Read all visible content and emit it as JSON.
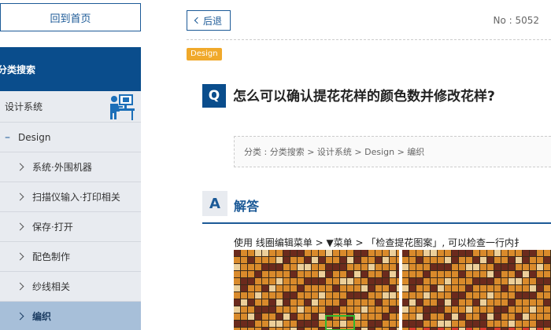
{
  "sidebar": {
    "home_label": "回到首页",
    "category_header": "分类搜索",
    "menu": {
      "system_label": "设计系统",
      "design_label": "Design",
      "design_toggle": "–",
      "items": [
        {
          "label": "系统·外围机器"
        },
        {
          "label": "扫描仪输入·打印相关"
        },
        {
          "label": "保存·打开"
        },
        {
          "label": "配色制作"
        },
        {
          "label": "纱线相关"
        },
        {
          "label": "编织",
          "active": true
        }
      ]
    }
  },
  "main": {
    "back_label": "后退",
    "number": "No : 5052",
    "tag": "Design",
    "q_mark": "Q",
    "question": "怎么可以确认提花花样的颜色数并修改花样?",
    "breadcrumb": "分类 : 分类搜索 > 设计系统 > Design > 编织",
    "a_mark": "A",
    "answer_title": "解答",
    "answer_text": "使用 线圈编辑菜单 > ▼菜单 > 「检查提花图案」, 可以检查一行内扌"
  },
  "colors": {
    "brand_blue": "#0a4d8c",
    "tag_orange": "#f0a92b",
    "sidebar_bg": "#e8ebf0",
    "active_bg": "#a7bfd9",
    "pattern_orange": "#d98a2b",
    "pattern_brown": "#6b2a1d",
    "pattern_cream": "#eccf9a",
    "pattern_red": "#d93a2e"
  }
}
